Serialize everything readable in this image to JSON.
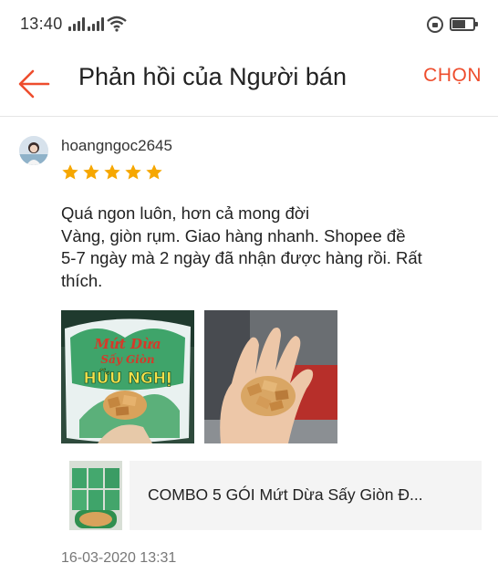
{
  "status_bar": {
    "time": "13:40"
  },
  "header": {
    "title": "Phản hồi của Người bán",
    "action_label": "CHỌN"
  },
  "review": {
    "username": "hoangngoc2645",
    "rating": 5,
    "text_lines": [
      "Quá ngon luôn, hơn cả mong đời",
      "Vàng, giòn rụm. Giao hàng nhanh. Shopee đề",
      "5-7 ngày mà 2 ngày đã nhận được hàng rồi. Rất",
      "thích."
    ],
    "photo1_package_text": {
      "line1": "Mứt Dừa",
      "line2": "Sấy Giòn",
      "brand": "HỮU NGHỊ"
    },
    "product_name": "COMBO 5 GÓI  Mứt Dừa Sấy Giòn Đ...",
    "date": "16-03-2020 13:31"
  },
  "colors": {
    "accent": "#ee4d2d",
    "star": "#f6a700"
  }
}
